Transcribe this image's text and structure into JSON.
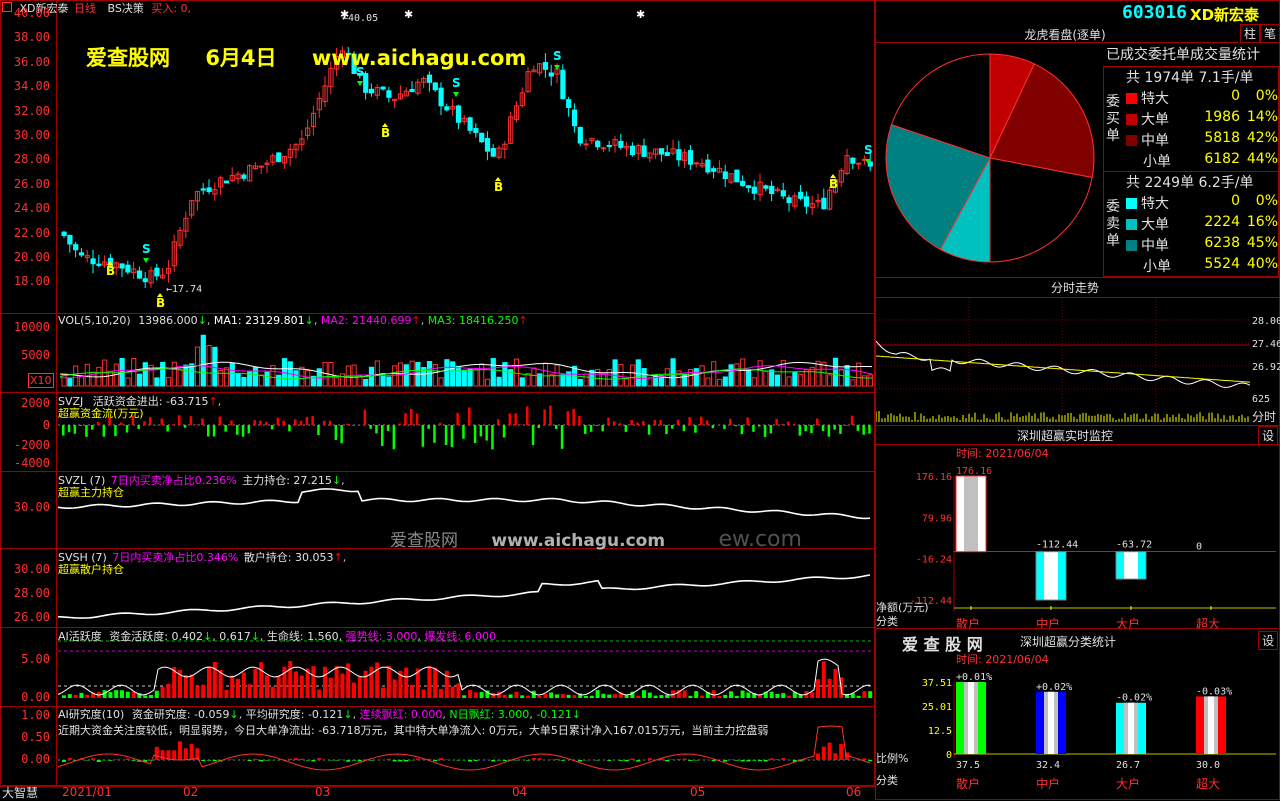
{
  "header": {
    "title_left": "XD新宏泰",
    "period": "日线",
    "bs_label": "BS决策",
    "bs_state": "买入: 0,",
    "stock_code": "603016",
    "stock_name": "XD新宏泰",
    "btn_a": "柱",
    "btn_b": "笔"
  },
  "watermark": {
    "site": "爱查股网",
    "date": "6月4日",
    "url": "www.aichagu.com",
    "center_site": "爱查股网",
    "center_url": "www.aichagu.com",
    "center_tail": "ew.com"
  },
  "price_axis": [
    "40.00",
    "38.00",
    "36.00",
    "34.00",
    "32.00",
    "30.00",
    "28.00",
    "26.00",
    "24.00",
    "22.00",
    "20.00",
    "18.00"
  ],
  "price_marks": {
    "high": "40.05",
    "low": "17.74"
  },
  "signals": {
    "buy": "B",
    "sell": "S"
  },
  "vol": {
    "header": "VOL(5,10,20)",
    "value": "13986.000",
    "ma1": "MA1: 23129.801",
    "ma2": "MA2: 21440.699",
    "ma3": "MA3: 18416.250",
    "axis": [
      "10000",
      "5000"
    ],
    "unit": "X10",
    "ma1_color": "#ffffff",
    "ma2_color": "#ff00ff",
    "ma3_color": "#00ff00"
  },
  "svzj": {
    "name": "SVZJ",
    "label": "活跃资金进出: -63.715",
    "sub": "超赢资金流(万元)",
    "axis": [
      "2000",
      "0",
      "-2000",
      "-4000"
    ]
  },
  "svzl": {
    "name": "SVZL (7)",
    "ratio": "7日内买卖净占比0.236%",
    "hold": "主力持仓: 27.215",
    "sub": "超赢主力持仓",
    "axis": [
      "30.00"
    ]
  },
  "svsh": {
    "name": "SVSH (7)",
    "ratio": "7日内买卖净占比0.346%",
    "hold": "散户持仓: 30.053",
    "sub": "超赢散户持仓",
    "axis": [
      "30.00",
      "28.00",
      "26.00"
    ]
  },
  "ai_active": {
    "label": "AI活跃度",
    "a": "资金活跃度: 0.402",
    "b": "0.617",
    "c": "生命线: 1.560",
    "d": "强势线: 3.000",
    "e": "爆发线: 6.000",
    "axis": [
      "5.00",
      "0.00"
    ]
  },
  "ai_research": {
    "label": "AI研究度(10)",
    "a": "资金研究度: -0.059",
    "b": "平均研究度: -0.121",
    "c": "连续飘红: 0.000",
    "d": "N日飘红: 3.000",
    "e": "-0.121",
    "text": "近期大资金关注度较低，明显弱势，今日大单净流出: -63.718万元，其中特大单净流入: 0万元，大单5日累计净入167.015万元，当前主力控盘弱",
    "axis": [
      "1.00",
      "0.50",
      "0.00"
    ]
  },
  "bottom": {
    "brand": "大智慧",
    "dates": [
      "2021/01",
      "02",
      "03",
      "04",
      "05",
      "06"
    ]
  },
  "lhb": {
    "title": "龙虎看盘(逐单)",
    "subtitle": "已成交委托单成交量统计",
    "buy_head": "共 1974单 7.1手/单",
    "buy_side": "委买单",
    "sell_head": "共 2249单 6.2手/单",
    "sell_side": "委卖单",
    "buy_rows": [
      {
        "name": "特大",
        "count": "0",
        "pct": "0%",
        "color": "#ff0000"
      },
      {
        "name": "大单",
        "count": "1986",
        "pct": "14%",
        "color": "#c00000"
      },
      {
        "name": "中单",
        "count": "5818",
        "pct": "42%",
        "color": "#800000"
      },
      {
        "name": "小单",
        "count": "6182",
        "pct": "44%",
        "color": "#000000"
      }
    ],
    "sell_rows": [
      {
        "name": "特大",
        "count": "0",
        "pct": "0%",
        "color": "#00ffff"
      },
      {
        "name": "大单",
        "count": "2224",
        "pct": "16%",
        "color": "#00c0c0"
      },
      {
        "name": "中单",
        "count": "6238",
        "pct": "45%",
        "color": "#008080"
      },
      {
        "name": "小单",
        "count": "5524",
        "pct": "40%",
        "color": "#000000"
      }
    ]
  },
  "intraday": {
    "title": "分时走势",
    "axis": [
      "28.00",
      "27.46",
      "26.92"
    ],
    "vol_label": "625",
    "time_label": "分时"
  },
  "monitor": {
    "title": "深圳超赢实时监控",
    "set": "设",
    "time": "时间: 2021/06/04",
    "axis": [
      "176.16",
      "79.96",
      "-16.24",
      "-112.44"
    ],
    "vals": [
      "176.16",
      "-112.44",
      "-63.72",
      "0"
    ],
    "ylabel": "净额(万元)",
    "xlabel": "分类",
    "cats": [
      "散户",
      "中户",
      "大户",
      "超大"
    ]
  },
  "classify": {
    "brand": "爱 查 股 网",
    "title": "深圳超赢分类统计",
    "set": "设",
    "time": "时间: 2021/06/04",
    "axis": [
      "37.51",
      "25.01",
      "12.5",
      "0"
    ],
    "deltas": [
      "+0.01%",
      "+0.02%",
      "-0.02%",
      "-0.03%"
    ],
    "vals": [
      "37.5",
      "32.4",
      "26.7",
      "30.0"
    ],
    "ylabel": "比例%",
    "xlabel": "分类",
    "cats": [
      "散户",
      "中户",
      "大户",
      "超大"
    ]
  },
  "chart_data": [
    {
      "type": "pie",
      "title": "龙虎看盘(逐单)",
      "categories": [
        "买-特大",
        "买-大单",
        "买-中单",
        "买-小单",
        "卖-特大",
        "卖-大单",
        "卖-中单",
        "卖-小单"
      ],
      "values": [
        0,
        14,
        42,
        44,
        0,
        16,
        45,
        40
      ]
    },
    {
      "type": "bar",
      "title": "深圳超赢实时监控",
      "categories": [
        "散户",
        "中户",
        "大户",
        "超大"
      ],
      "values": [
        176.16,
        -112.44,
        -63.72,
        0
      ],
      "ylim": [
        -112.44,
        176.16
      ]
    },
    {
      "type": "bar",
      "title": "深圳超赢分类统计",
      "categories": [
        "散户",
        "中户",
        "大户",
        "超大"
      ],
      "values": [
        37.5,
        32.4,
        26.7,
        30.0
      ],
      "ylim": [
        0,
        37.51
      ]
    }
  ]
}
